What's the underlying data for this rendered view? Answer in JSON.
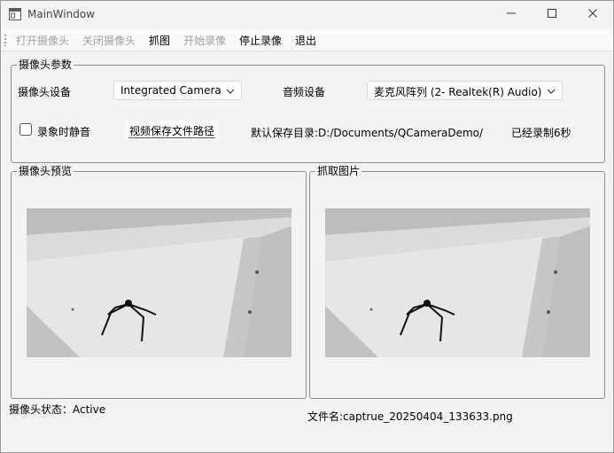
{
  "window": {
    "title": "MainWindow"
  },
  "toolbar": {
    "open_camera": "打开摄像头",
    "close_camera": "关闭摄像头",
    "capture": "抓图",
    "start_record": "开始录像",
    "stop_record": "停止录像",
    "exit": "退出"
  },
  "params": {
    "group_title": "摄像头参数",
    "camera_device_label": "摄像头设备",
    "camera_device_value": "Integrated Camera",
    "audio_device_label": "音频设备",
    "audio_device_value": "麦克风阵列 (2- Realtek(R) Audio)",
    "mute_label": "录象时静音",
    "mute_checked": false,
    "save_path_button": "视频保存文件路径",
    "default_dir": "默认保存目录:D:/Documents/QCameraDemo/",
    "recorded_time": "已经录制6秒"
  },
  "preview": {
    "group_title": "摄像头预览"
  },
  "capture": {
    "group_title": "抓取图片"
  },
  "status": {
    "camera_state": "摄像头状态：Active",
    "file_name": "文件名:captrue_20250404_133633.png"
  },
  "icons": {
    "app": "app-window-icon",
    "minimize": "minimize-icon",
    "maximize": "maximize-icon",
    "close": "close-icon",
    "dropdown": "chevron-down-icon"
  }
}
